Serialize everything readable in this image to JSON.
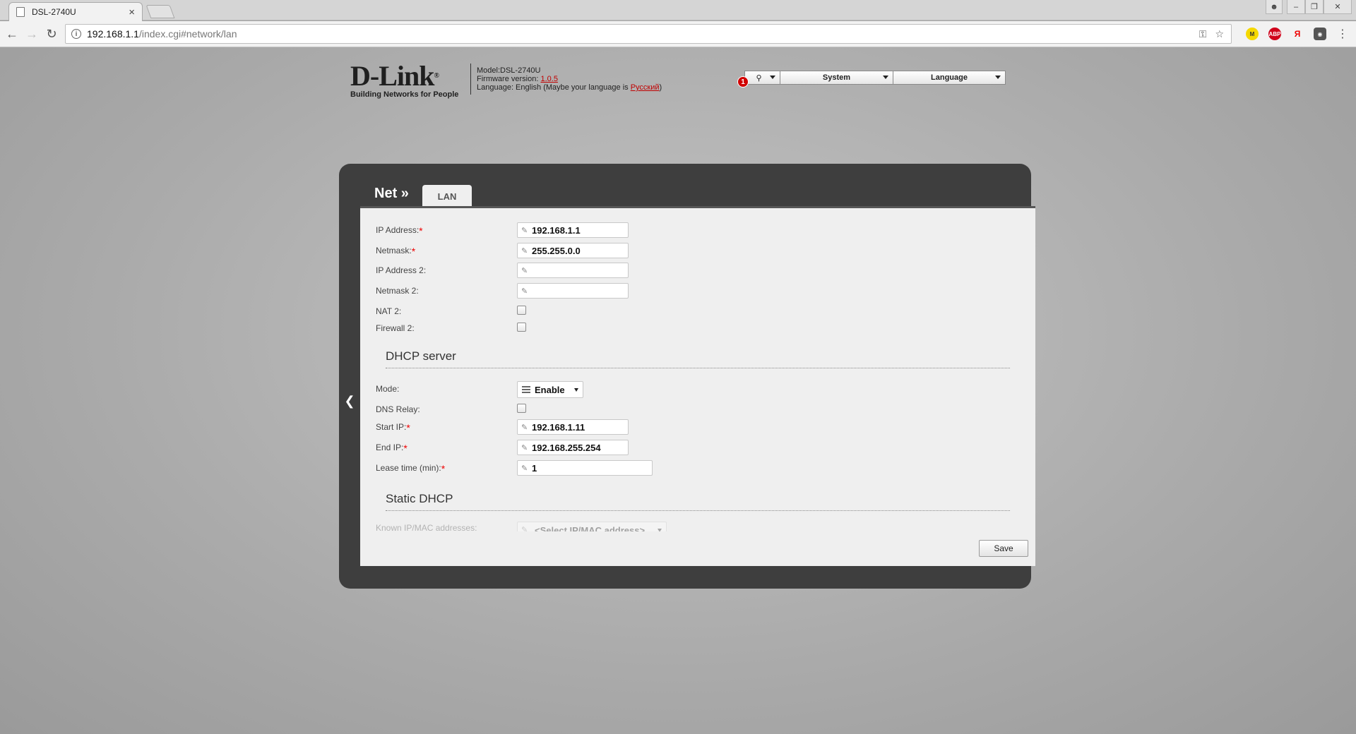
{
  "browser": {
    "tab_title": "DSL-2740U",
    "tab_close": "×",
    "url_host": "192.168.1.1",
    "url_path": "/index.cgi#network/lan",
    "info_glyph": "i",
    "ext_m": "M",
    "ext_abp": "ABP",
    "ext_ya": "Я"
  },
  "header": {
    "logo": "D-Link",
    "logo_reg": "®",
    "tagline": "Building Networks for People",
    "model": "Model:DSL-2740U",
    "firmware_label": "Firmware version: ",
    "firmware_version": "1.0.5",
    "language_prefix": "Language: English (Maybe your language is ",
    "language_link": "Русский",
    "language_suffix": ")",
    "notification_count": "1",
    "menu_system": "System",
    "menu_language": "Language"
  },
  "panel": {
    "breadcrumb": "Net »",
    "tab": "LAN",
    "collapse_glyph": "❮"
  },
  "lan": {
    "ip_label": "IP Address:",
    "ip_value": "192.168.1.1",
    "mask_label": "Netmask:",
    "mask_value": "255.255.0.0",
    "ip2_label": "IP Address 2:",
    "ip2_value": "",
    "mask2_label": "Netmask 2:",
    "mask2_value": "",
    "nat2_label": "NAT 2:",
    "firewall2_label": "Firewall 2:"
  },
  "dhcp": {
    "title": "DHCP server",
    "mode_label": "Mode:",
    "mode_value": "Enable",
    "dns_relay_label": "DNS Relay:",
    "start_ip_label": "Start IP:",
    "start_ip_value": "192.168.1.11",
    "end_ip_label": "End IP:",
    "end_ip_value": "192.168.255.254",
    "lease_label": "Lease time (min):",
    "lease_value": "1"
  },
  "static_dhcp": {
    "title": "Static DHCP",
    "known_label": "Known IP/MAC addresses:",
    "known_value": "<Select IP/MAC address>"
  },
  "actions": {
    "save": "Save"
  },
  "required_mark": "*"
}
